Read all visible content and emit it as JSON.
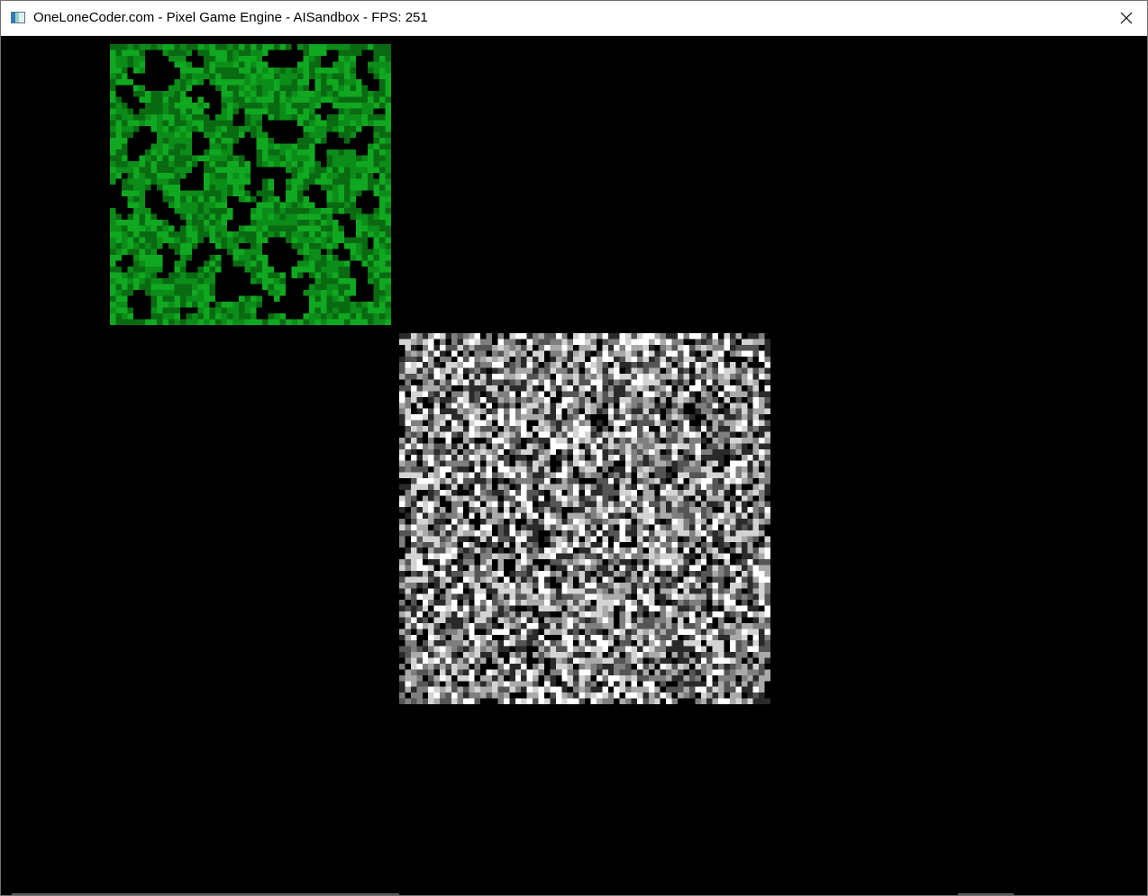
{
  "window": {
    "title": "OneLoneCoder.com - Pixel Game Engine - AISandbox - FPS: 251",
    "app_icon": "window-app-icon",
    "close_icon": "close-icon"
  },
  "canvas": {
    "background": "#000000",
    "grids": [
      {
        "name": "green-cell-grid",
        "cells": 48,
        "palette": [
          "#000000",
          "#0a6a12",
          "#0c8c18",
          "#10a820"
        ]
      },
      {
        "name": "grayscale-noise-grid",
        "cells": 64,
        "palette": [
          "#000000",
          "#2a2a2a",
          "#555555",
          "#7f7f7f",
          "#aaaaaa",
          "#d4d4d4",
          "#ffffff"
        ]
      }
    ]
  }
}
